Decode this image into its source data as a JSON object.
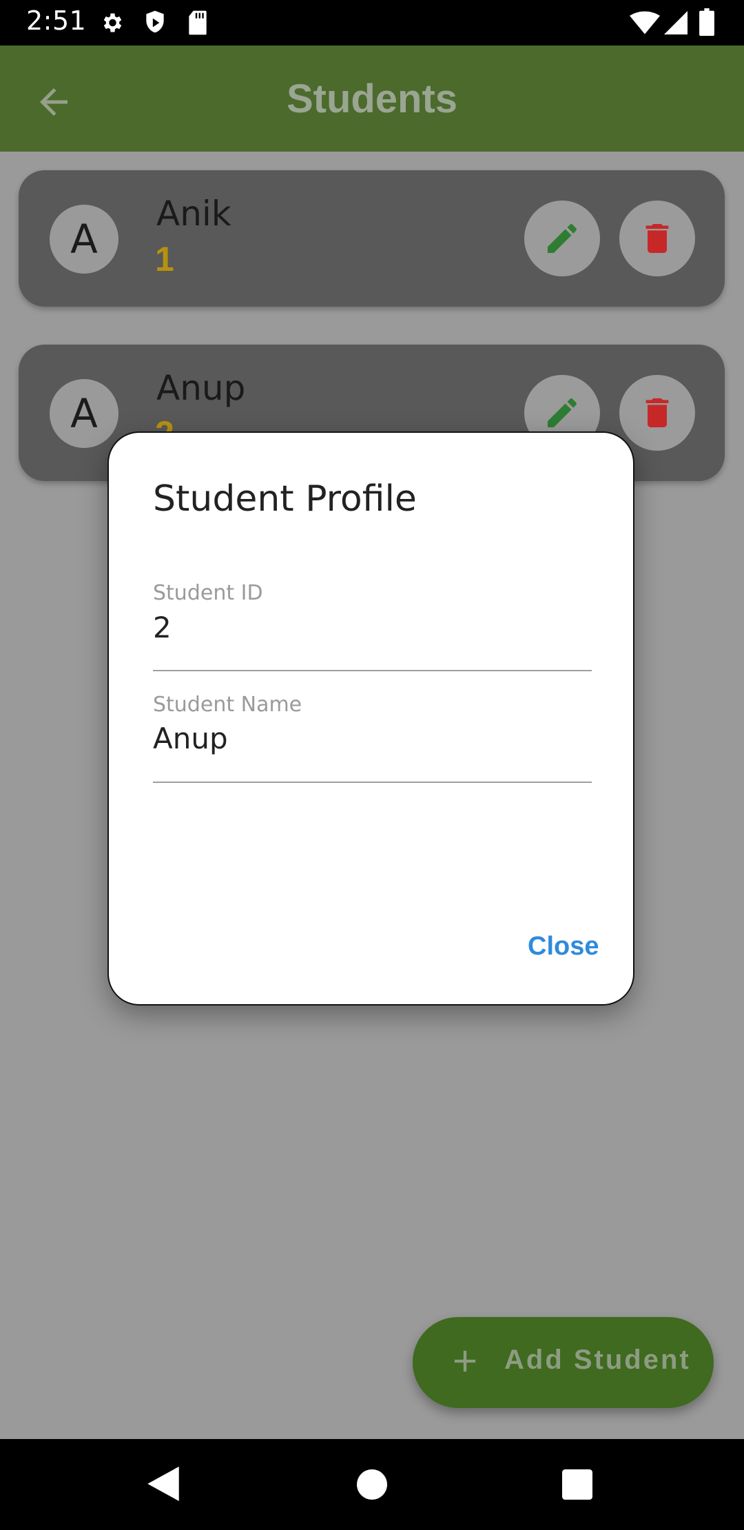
{
  "status_bar": {
    "time": "2:51"
  },
  "app_bar": {
    "title": "Students"
  },
  "students": [
    {
      "avatar_letter": "A",
      "name": "Anik",
      "id": "1"
    },
    {
      "avatar_letter": "A",
      "name": "Anup",
      "id": "2"
    }
  ],
  "dialog": {
    "title": "Student Profile",
    "id_label": "Student ID",
    "id_value": "2",
    "name_label": "Student Name",
    "name_value": "Anup",
    "close_label": "Close"
  },
  "fab": {
    "label": "Add Student"
  },
  "colors": {
    "app_bar": "#4b6a2c",
    "accent_blue": "#2f8bdc",
    "edit_green": "#2e7d32",
    "delete_red": "#c62828",
    "id_gold": "#b8920e"
  }
}
